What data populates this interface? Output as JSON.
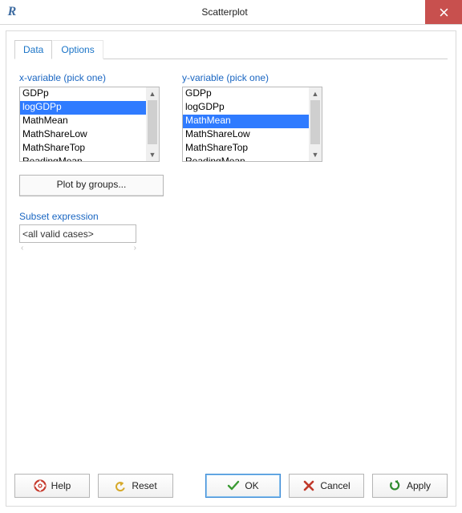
{
  "title": "Scatterplot",
  "appicon": "R",
  "tabs": {
    "data": "Data",
    "options": "Options"
  },
  "xvar": {
    "label": "x-variable (pick one)",
    "items": [
      "GDPp",
      "logGDPp",
      "MathMean",
      "MathShareLow",
      "MathShareTop",
      "ReadingMean"
    ],
    "selected": 1
  },
  "yvar": {
    "label": "y-variable (pick one)",
    "items": [
      "GDPp",
      "logGDPp",
      "MathMean",
      "MathShareLow",
      "MathShareTop",
      "ReadingMean"
    ],
    "selected": 2
  },
  "plotgroups": "Plot by groups...",
  "subset": {
    "label": "Subset expression",
    "value": "<all valid cases>"
  },
  "buttons": {
    "help": "Help",
    "reset": "Reset",
    "ok": "OK",
    "cancel": "Cancel",
    "apply": "Apply"
  }
}
